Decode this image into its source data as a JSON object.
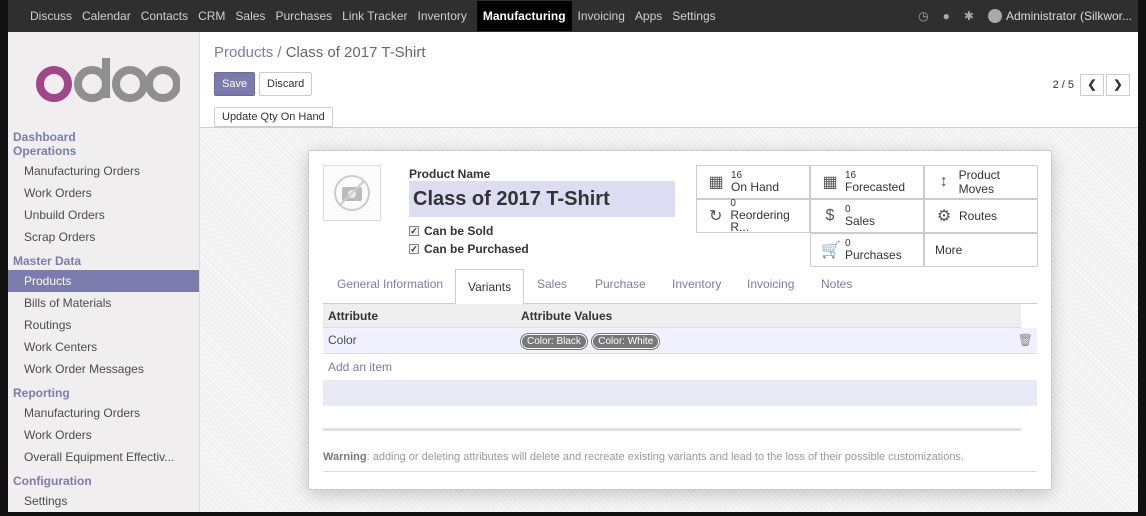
{
  "topbar": {
    "menu": [
      "Discuss",
      "Calendar",
      "Contacts",
      "CRM",
      "Sales",
      "Purchases",
      "Link Tracker",
      "Inventory",
      "Manufacturing",
      "Invoicing",
      "Apps",
      "Settings"
    ],
    "active": "Manufacturing",
    "user": "Administrator (Silkwor..."
  },
  "logo": "odoo",
  "sidebar": {
    "dashboard": "Dashboard",
    "operations": "Operations",
    "operations_items": [
      "Manufacturing Orders",
      "Work Orders",
      "Unbuild Orders",
      "Scrap Orders"
    ],
    "master_data": "Master Data",
    "master_items": [
      "Products",
      "Bills of Materials",
      "Routings",
      "Work Centers",
      "Work Order Messages"
    ],
    "reporting": "Reporting",
    "reporting_items": [
      "Manufacturing Orders",
      "Work Orders",
      "Overall Equipment Effectiv..."
    ],
    "configuration": "Configuration",
    "configuration_items": [
      "Settings"
    ]
  },
  "control": {
    "breadcrumb_parent": "Products /",
    "breadcrumb_current": "Class of 2017 T-Shirt",
    "save": "Save",
    "discard": "Discard",
    "pager": "2 / 5",
    "update_qty": "Update Qty On Hand"
  },
  "form": {
    "product_name_label": "Product Name",
    "product_name": "Class of 2017 T-Shirt",
    "can_be_sold": "Can be Sold",
    "can_be_purchased": "Can be Purchased",
    "stats": {
      "on_hand_num": "16",
      "on_hand_label": "On Hand",
      "forecasted_num": "16",
      "forecasted_label": "Forecasted",
      "product_moves": "Product Moves",
      "reordering_num": "0",
      "reordering_label": "Reordering R...",
      "sales_num": "0",
      "sales_label": "Sales",
      "routes": "Routes",
      "purchases_num": "0",
      "purchases_label": "Purchases",
      "more": "More"
    },
    "tabs": [
      "General Information",
      "Variants",
      "Sales",
      "Purchase",
      "Inventory",
      "Invoicing",
      "Notes"
    ],
    "active_tab": "Variants",
    "table": {
      "col_attribute": "Attribute",
      "col_values": "Attribute Values",
      "row_attribute": "Color",
      "row_values": [
        "Color: Black",
        "Color: White"
      ],
      "add_item": "Add an item"
    },
    "warning_bold": "Warning",
    "warning_text": ": adding or deleting attributes will delete and recreate existing variants and lead to the loss of their possible customizations."
  }
}
